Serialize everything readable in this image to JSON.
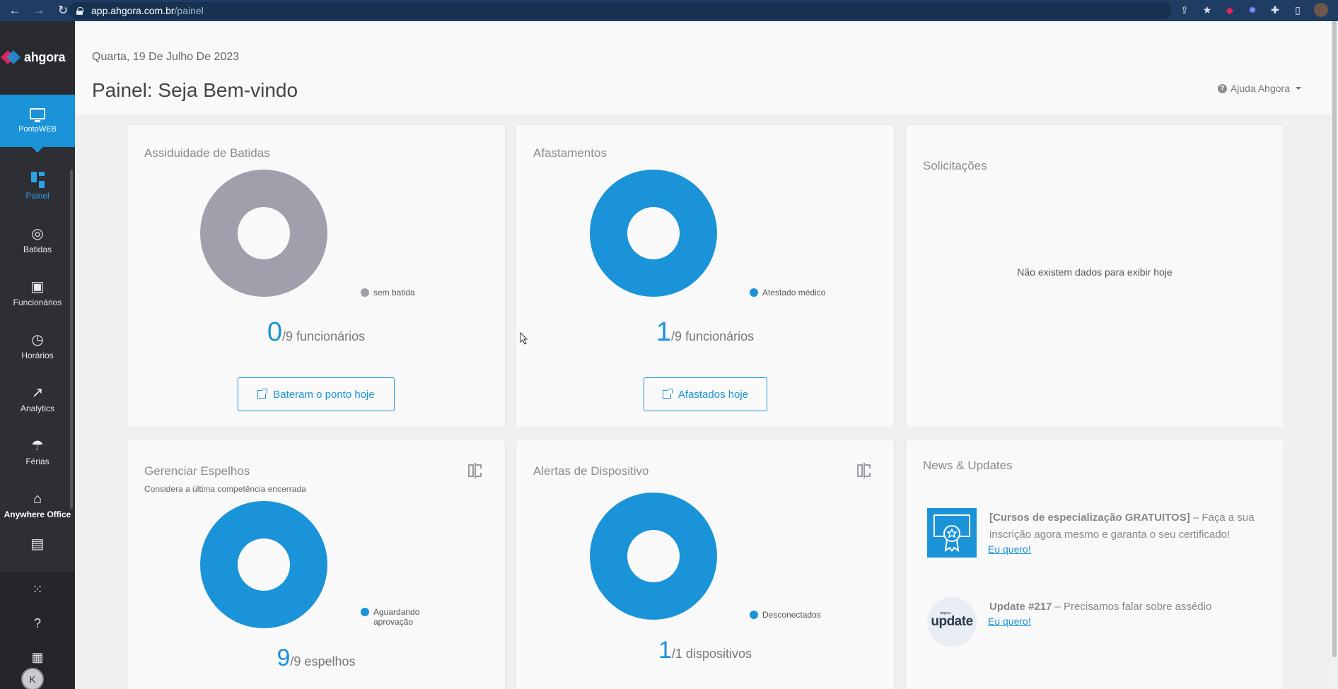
{
  "browser": {
    "url_host": "app.ahgora.com.br",
    "url_path": "/painel"
  },
  "brand": {
    "name": "ahgora"
  },
  "sidebar": {
    "module": "PontoWEB",
    "items": [
      {
        "label": "Painel",
        "icon": "dashboard-icon"
      },
      {
        "label": "Batidas",
        "icon": "fingerprint-icon"
      },
      {
        "label": "Funcionários",
        "icon": "badge-icon"
      },
      {
        "label": "Horários",
        "icon": "clock-icon"
      },
      {
        "label": "Analytics",
        "icon": "trend-icon"
      },
      {
        "label": "Férias",
        "icon": "beach-icon"
      },
      {
        "label": "Anywhere Office",
        "icon": "home-office-icon"
      }
    ],
    "user_initial": "K"
  },
  "header": {
    "date": "Quarta, 19 De Julho De 2023",
    "title": "Painel: Seja Bem-vindo",
    "help": "Ajuda Ahgora"
  },
  "cards": {
    "assiduidade": {
      "title": "Assiduidade de Batidas",
      "legend": "sem batida",
      "legend_color": "#a09fab",
      "count": "0",
      "total": "/9 funcionários",
      "button": "Bateram o ponto hoje"
    },
    "afastamentos": {
      "title": "Afastamentos",
      "legend": "Atestado médico",
      "legend_color": "#1a93d9",
      "count": "1",
      "total": "/9 funcionários",
      "button": "Afastados hoje"
    },
    "solicitacoes": {
      "title": "Solicitações",
      "empty": "Não existem dados para exibir hoje"
    },
    "espelhos": {
      "title": "Gerenciar Espelhos",
      "subtitle": "Considera a última competência encerrada",
      "legend": "Aguardando aprovação",
      "legend_color": "#1a93d9",
      "count": "9",
      "total": "/9 espelhos"
    },
    "alertas": {
      "title": "Alertas de Dispositivo",
      "legend": "Desconectados",
      "legend_color": "#1a93d9",
      "count": "1",
      "total": "/1 dispositivos"
    },
    "news": {
      "title": "News & Updates",
      "items": [
        {
          "bold": "[Cursos de especialização GRATUITOS]",
          "text": " – Faça a sua inscrição agora mesmo e garanta o seu certificado!",
          "link": "Eu quero!",
          "thumb_icon": "certificate-icon"
        },
        {
          "bold": "Update #217",
          "text": " – Precisamos falar sobre assédio",
          "link": "Eu quero!",
          "thumb_icon": "update-logo-icon",
          "thumb_top": "ahgora",
          "thumb_label": "update"
        }
      ]
    }
  }
}
